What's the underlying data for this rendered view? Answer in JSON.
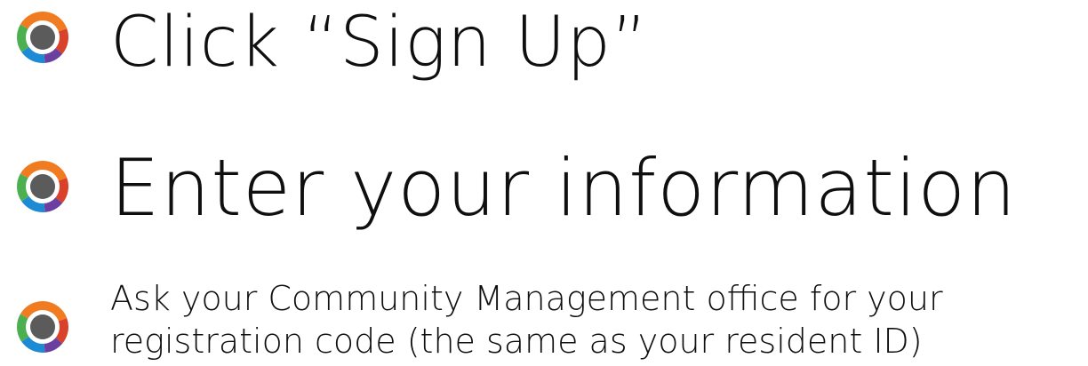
{
  "steps": [
    {
      "text": "Click “Sign Up”"
    },
    {
      "text": "Enter your information"
    },
    {
      "line1": "Ask your Community Management office for your",
      "line2": "registration code (the same as your resident ID)"
    }
  ],
  "bullet_icon": "multicolor-ring-bullet-icon",
  "colors": {
    "text": "#0f0f0f",
    "ring_orange": "#f07b21",
    "ring_red": "#d9412b",
    "ring_purple": "#6b3fa0",
    "ring_blue": "#1c8bd3",
    "ring_green": "#4caf50",
    "center": "#5b5b5b"
  }
}
